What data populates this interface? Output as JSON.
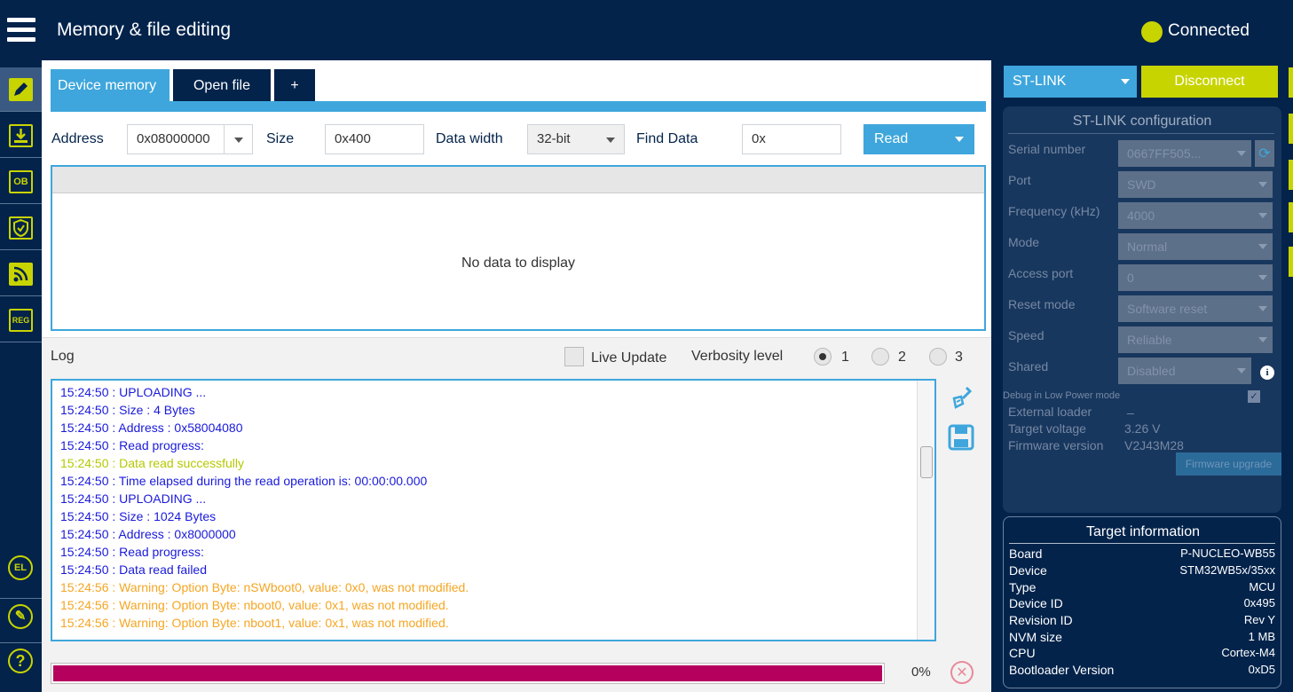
{
  "header": {
    "title": "Memory & file editing",
    "status": "Connected",
    "status_color": "#c8d400"
  },
  "sidebar": {
    "items": [
      {
        "name": "edit-icon",
        "label": ""
      },
      {
        "name": "download-icon",
        "label": ""
      },
      {
        "name": "ob-icon",
        "label": "OB"
      },
      {
        "name": "shield-icon",
        "label": ""
      },
      {
        "name": "rss-icon",
        "label": ""
      },
      {
        "name": "reg-icon",
        "label": "REG"
      }
    ],
    "bottom_items": [
      {
        "name": "el-icon",
        "label": "EL"
      },
      {
        "name": "pen-icon",
        "label": "✎"
      },
      {
        "name": "help-icon",
        "label": "?"
      }
    ]
  },
  "tabs": [
    {
      "label": "Device memory",
      "active": true
    },
    {
      "label": "Open file",
      "active": false
    },
    {
      "label": "+",
      "active": false
    }
  ],
  "toolbar": {
    "address_label": "Address",
    "address_value": "0x08000000",
    "size_label": "Size",
    "size_value": "0x400",
    "data_width_label": "Data width",
    "data_width_value": "32-bit",
    "find_label": "Find Data",
    "find_value": "0x",
    "read_label": "Read"
  },
  "data_panel": {
    "empty_text": "No data to display"
  },
  "log": {
    "title": "Log",
    "live_update_label": "Live Update",
    "verbosity_label": "Verbosity level",
    "verbosity_options": [
      "1",
      "2",
      "3"
    ],
    "verbosity_selected": "1",
    "lines": [
      {
        "text": "15:24:50 : UPLOADING ...",
        "color": "#1a1adb"
      },
      {
        "text": "15:24:50 :   Size        : 4 Bytes",
        "color": "#1a1adb"
      },
      {
        "text": "15:24:50 :   Address      : 0x58004080",
        "color": "#1a1adb"
      },
      {
        "text": "15:24:50 : Read progress:",
        "color": "#1a1adb"
      },
      {
        "text": "15:24:50 : Data read successfully",
        "color": "#b5c900"
      },
      {
        "text": "15:24:50 : Time elapsed during the read operation is: 00:00:00.000",
        "color": "#1a1adb"
      },
      {
        "text": "15:24:50 : UPLOADING ...",
        "color": "#1a1adb"
      },
      {
        "text": "15:24:50 :   Size        : 1024 Bytes",
        "color": "#1a1adb"
      },
      {
        "text": "15:24:50 :   Address      : 0x8000000",
        "color": "#1a1adb"
      },
      {
        "text": "15:24:50 : Read progress:",
        "color": "#1a1adb"
      },
      {
        "text": "15:24:50 : Data read failed",
        "color": "#1a1adb"
      },
      {
        "text": "15:24:56 : Warning: Option Byte: nSWboot0, value: 0x0, was not modified.",
        "color": "#f5a623"
      },
      {
        "text": "15:24:56 : Warning: Option Byte: nboot0, value: 0x1, was not modified.",
        "color": "#f5a623"
      },
      {
        "text": "15:24:56 : Warning: Option Byte: nboot1, value: 0x1, was not modified.",
        "color": "#f5a623"
      }
    ],
    "progress_percent": 0,
    "progress_fill_fraction": 1.0,
    "progress_text": "0%"
  },
  "right_panel": {
    "interface": "ST-LINK",
    "disconnect_label": "Disconnect",
    "config_title": "ST-LINK configuration",
    "config": [
      {
        "label": "Serial number",
        "value": "0667FF505..."
      },
      {
        "label": "Port",
        "value": "SWD"
      },
      {
        "label": "Frequency (kHz)",
        "value": "4000"
      },
      {
        "label": "Mode",
        "value": "Normal"
      },
      {
        "label": "Access port",
        "value": "0"
      },
      {
        "label": "Reset mode",
        "value": "Software reset"
      },
      {
        "label": "Speed",
        "value": "Reliable"
      },
      {
        "label": "Shared",
        "value": "Disabled"
      }
    ],
    "debug_low_power_label": "Debug in Low Power mode",
    "external_loader_label": "External loader",
    "external_loader_value": "_",
    "target_voltage_label": "Target voltage",
    "target_voltage_value": "3.26 V",
    "firmware_version_label": "Firmware version",
    "firmware_version_value": "V2J43M28",
    "firmware_upgrade_label": "Firmware upgrade",
    "target_info_title": "Target information",
    "target_info": [
      {
        "label": "Board",
        "value": "P-NUCLEO-WB55"
      },
      {
        "label": "Device",
        "value": "STM32WB5x/35xx"
      },
      {
        "label": "Type",
        "value": "MCU"
      },
      {
        "label": "Device ID",
        "value": "0x495"
      },
      {
        "label": "Revision ID",
        "value": "Rev Y"
      },
      {
        "label": "NVM size",
        "value": "1 MB"
      },
      {
        "label": "CPU",
        "value": "Cortex-M4"
      },
      {
        "label": "Bootloader Version",
        "value": "0xD5"
      }
    ]
  }
}
